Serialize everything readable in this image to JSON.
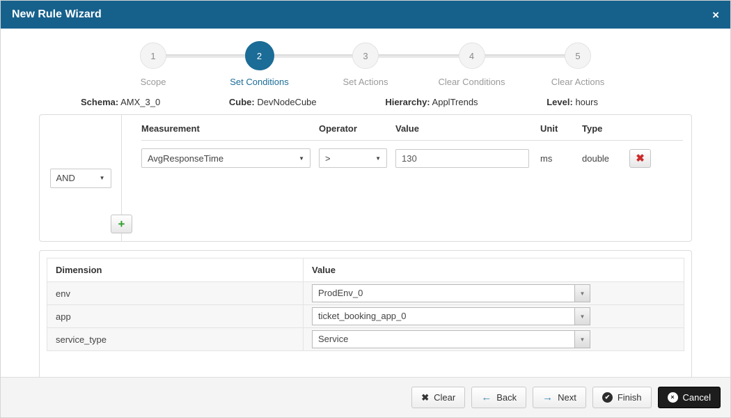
{
  "colors": {
    "accent": "#16618c",
    "danger": "#cc2a2a",
    "success": "#2f9e2f"
  },
  "icons": {
    "close": "×",
    "dropdown": "▼",
    "delete": "✖",
    "add": "+",
    "clear": "✖",
    "back": "←",
    "next": "→",
    "finish": "✔",
    "cancel": "×"
  },
  "header": {
    "title": "New Rule Wizard"
  },
  "stepper": {
    "steps": [
      {
        "number": "1",
        "label": "Scope"
      },
      {
        "number": "2",
        "label": "Set Conditions"
      },
      {
        "number": "3",
        "label": "Set Actions"
      },
      {
        "number": "4",
        "label": "Clear Conditions"
      },
      {
        "number": "5",
        "label": "Clear Actions"
      }
    ]
  },
  "context": {
    "items": [
      {
        "label": "Schema:",
        "value": "AMX_3_0"
      },
      {
        "label": "Cube:",
        "value": "DevNodeCube"
      },
      {
        "label": "Hierarchy:",
        "value": "ApplTrends"
      },
      {
        "label": "Level:",
        "value": "hours"
      }
    ]
  },
  "conditions": {
    "logic_operator": "AND",
    "columns": {
      "measurement": "Measurement",
      "operator": "Operator",
      "value": "Value",
      "unit": "Unit",
      "type": "Type"
    },
    "rows": [
      {
        "measurement": "AvgResponseTime",
        "operator": ">",
        "value": "130",
        "unit": "ms",
        "type": "double"
      }
    ]
  },
  "dimensions": {
    "columns": {
      "dimension": "Dimension",
      "value": "Value"
    },
    "rows": [
      {
        "dimension": "env",
        "value": "ProdEnv_0"
      },
      {
        "dimension": "app",
        "value": "ticket_booking_app_0"
      },
      {
        "dimension": "service_type",
        "value": "Service"
      }
    ]
  },
  "footer": {
    "clear": "Clear",
    "back": "Back",
    "next": "Next",
    "finish": "Finish",
    "cancel": "Cancel"
  }
}
